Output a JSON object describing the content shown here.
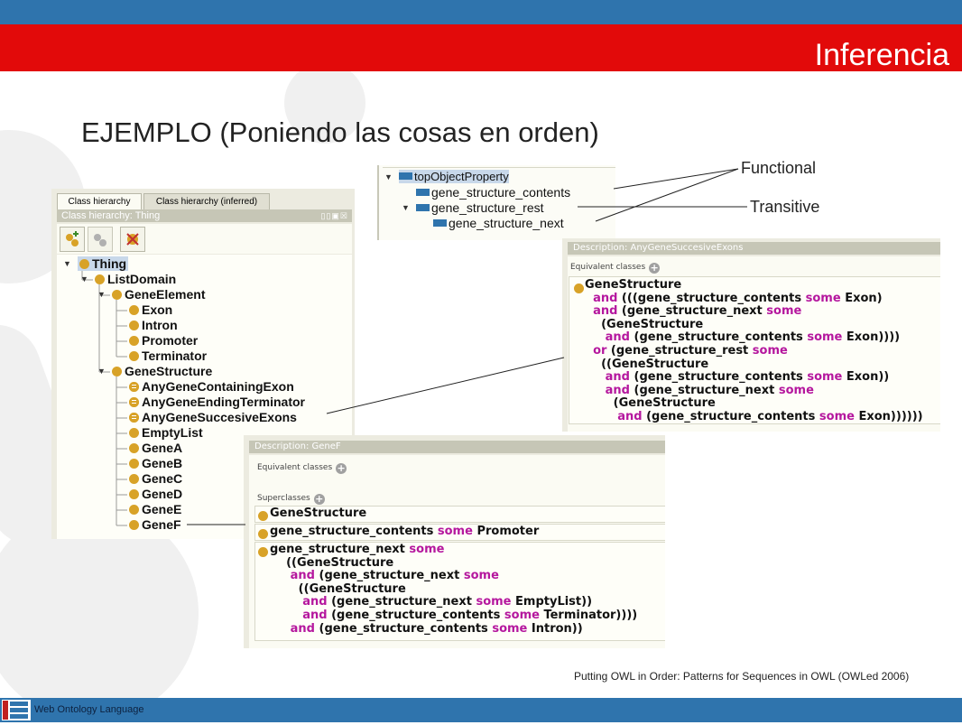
{
  "slide": {
    "title": "Inferencia",
    "heading": "EJEMPLO (Poniendo las cosas en orden)",
    "citation": "Putting OWL in Order: Patterns for Sequences in OWL (OWLed 2006)",
    "footer": "Web Ontology Language",
    "annotations": {
      "functional": "Functional",
      "transitive": "Transitive"
    }
  },
  "class_panel": {
    "tabs": [
      "Class hierarchy",
      "Class hierarchy (inferred)"
    ],
    "header": "Class hierarchy: Thing",
    "tree": [
      {
        "label": "Thing",
        "level": 0,
        "toggle": "open",
        "eq": false
      },
      {
        "label": "ListDomain",
        "level": 1,
        "toggle": "open",
        "eq": false
      },
      {
        "label": "GeneElement",
        "level": 2,
        "toggle": "open",
        "eq": false
      },
      {
        "label": "Exon",
        "level": 3,
        "toggle": "",
        "eq": false
      },
      {
        "label": "Intron",
        "level": 3,
        "toggle": "",
        "eq": false
      },
      {
        "label": "Promoter",
        "level": 3,
        "toggle": "",
        "eq": false
      },
      {
        "label": "Terminator",
        "level": 3,
        "toggle": "",
        "eq": false
      },
      {
        "label": "GeneStructure",
        "level": 2,
        "toggle": "open",
        "eq": false
      },
      {
        "label": "AnyGeneContainingExon",
        "level": 3,
        "toggle": "",
        "eq": true
      },
      {
        "label": "AnyGeneEndingTerminator",
        "level": 3,
        "toggle": "",
        "eq": true
      },
      {
        "label": "AnyGeneSuccesiveExons",
        "level": 3,
        "toggle": "",
        "eq": true
      },
      {
        "label": "EmptyList",
        "level": 3,
        "toggle": "",
        "eq": false
      },
      {
        "label": "GeneA",
        "level": 3,
        "toggle": "",
        "eq": false
      },
      {
        "label": "GeneB",
        "level": 3,
        "toggle": "",
        "eq": false
      },
      {
        "label": "GeneC",
        "level": 3,
        "toggle": "",
        "eq": false
      },
      {
        "label": "GeneD",
        "level": 3,
        "toggle": "",
        "eq": false
      },
      {
        "label": "GeneE",
        "level": 3,
        "toggle": "",
        "eq": false
      },
      {
        "label": "GeneF",
        "level": 3,
        "toggle": "",
        "eq": false
      }
    ]
  },
  "property_panel": {
    "items": [
      {
        "label": "topObjectProperty",
        "level": 0,
        "toggle": "open"
      },
      {
        "label": "gene_structure_contents",
        "level": 1,
        "toggle": ""
      },
      {
        "label": "gene_structure_rest",
        "level": 1,
        "toggle": "open"
      },
      {
        "label": "gene_structure_next",
        "level": 2,
        "toggle": ""
      }
    ]
  },
  "desc_exons": {
    "header": "Description: AnyGeneSuccesiveExons",
    "equivalent_label": "Equivalent classes",
    "lines": [
      [
        [
          "GeneStructure",
          ""
        ]
      ],
      [
        [
          "  ",
          ""
        ],
        [
          "and",
          "kw"
        ],
        [
          " (((gene_structure_contents ",
          ""
        ],
        [
          "some",
          "kw"
        ],
        [
          " Exon)",
          ""
        ]
      ],
      [
        [
          "  ",
          ""
        ],
        [
          "and",
          "kw"
        ],
        [
          " (gene_structure_next ",
          ""
        ],
        [
          "some",
          "kw"
        ]
      ],
      [
        [
          "    (GeneStructure",
          ""
        ]
      ],
      [
        [
          "     ",
          ""
        ],
        [
          "and",
          "kw"
        ],
        [
          " (gene_structure_contents ",
          ""
        ],
        [
          "some",
          "kw"
        ],
        [
          " Exon))))",
          ""
        ]
      ],
      [
        [
          "  ",
          ""
        ],
        [
          "or",
          "kw"
        ],
        [
          " (gene_structure_rest ",
          ""
        ],
        [
          "some",
          "kw"
        ]
      ],
      [
        [
          "    ((GeneStructure",
          ""
        ]
      ],
      [
        [
          "     ",
          ""
        ],
        [
          "and",
          "kw"
        ],
        [
          " (gene_structure_contents ",
          ""
        ],
        [
          "some",
          "kw"
        ],
        [
          " Exon))",
          ""
        ]
      ],
      [
        [
          "     ",
          ""
        ],
        [
          "and",
          "kw"
        ],
        [
          " (gene_structure_next ",
          ""
        ],
        [
          "some",
          "kw"
        ]
      ],
      [
        [
          "       (GeneStructure",
          ""
        ]
      ],
      [
        [
          "        ",
          ""
        ],
        [
          "and",
          "kw"
        ],
        [
          " (gene_structure_contents ",
          ""
        ],
        [
          "some",
          "kw"
        ],
        [
          " Exon))))))",
          ""
        ]
      ]
    ]
  },
  "desc_genef": {
    "header": "Description: GeneF",
    "equivalent_label": "Equivalent classes",
    "superclasses_label": "Superclasses",
    "super1": [
      [
        "GeneStructure",
        ""
      ]
    ],
    "super2": [
      [
        "gene_structure_contents ",
        ""
      ],
      [
        "some",
        "kw"
      ],
      [
        " Promoter",
        ""
      ]
    ],
    "super3": [
      [
        [
          "gene_structure_next ",
          ""
        ],
        [
          "some",
          "kw"
        ]
      ],
      [
        [
          "    ((GeneStructure",
          ""
        ]
      ],
      [
        [
          "     ",
          ""
        ],
        [
          "and",
          "kw"
        ],
        [
          " (gene_structure_next ",
          ""
        ],
        [
          "some",
          "kw"
        ]
      ],
      [
        [
          "       ((GeneStructure",
          ""
        ]
      ],
      [
        [
          "        ",
          ""
        ],
        [
          "and",
          "kw"
        ],
        [
          " (gene_structure_next ",
          ""
        ],
        [
          "some",
          "kw"
        ],
        [
          " EmptyList))",
          ""
        ]
      ],
      [
        [
          "        ",
          ""
        ],
        [
          "and",
          "kw"
        ],
        [
          " (gene_structure_contents ",
          ""
        ],
        [
          "some",
          "kw"
        ],
        [
          " Terminator))))",
          ""
        ]
      ],
      [
        [
          "     ",
          ""
        ],
        [
          "and",
          "kw"
        ],
        [
          " (gene_structure_contents ",
          ""
        ],
        [
          "some",
          "kw"
        ],
        [
          " Intron))",
          ""
        ]
      ]
    ]
  },
  "colors": {
    "top_blue": "#2f74ad",
    "title_red": "#e20a0a",
    "keyword": "#b5179e",
    "class_dot": "#d8a227",
    "property_bar": "#2f74ad"
  }
}
